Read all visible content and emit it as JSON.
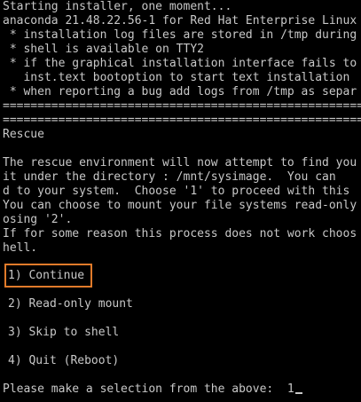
{
  "boot": {
    "line1": "Starting installer, one moment...",
    "line2": "anaconda 21.48.22.56-1 for Red Hat Enterprise Linux",
    "bullets": [
      " * installation log files are stored in /tmp during",
      " * shell is available on TTY2",
      " * if the graphical installation interface fails to",
      "   inst.text bootoption to start text installation",
      " * when reporting a bug add logs from /tmp as separ"
    ],
    "separator": "=================================================================="
  },
  "rescue": {
    "heading": "Rescue",
    "message": [
      "The rescue environment will now attempt to find you",
      "it under the directory : /mnt/sysimage.  You can",
      "d to your system.  Choose '1' to proceed with this",
      "You can choose to mount your file systems read-only",
      "osing '2'.",
      "If for some reason this process does not work choos",
      "hell."
    ]
  },
  "menu": {
    "options": [
      "1) Continue",
      "2) Read-only mount",
      "3) Skip to shell",
      "4) Quit (Reboot)"
    ],
    "highlight_color": "#e07a2a"
  },
  "prompt": {
    "text": "Please make a selection from the above:  ",
    "value": "1"
  }
}
